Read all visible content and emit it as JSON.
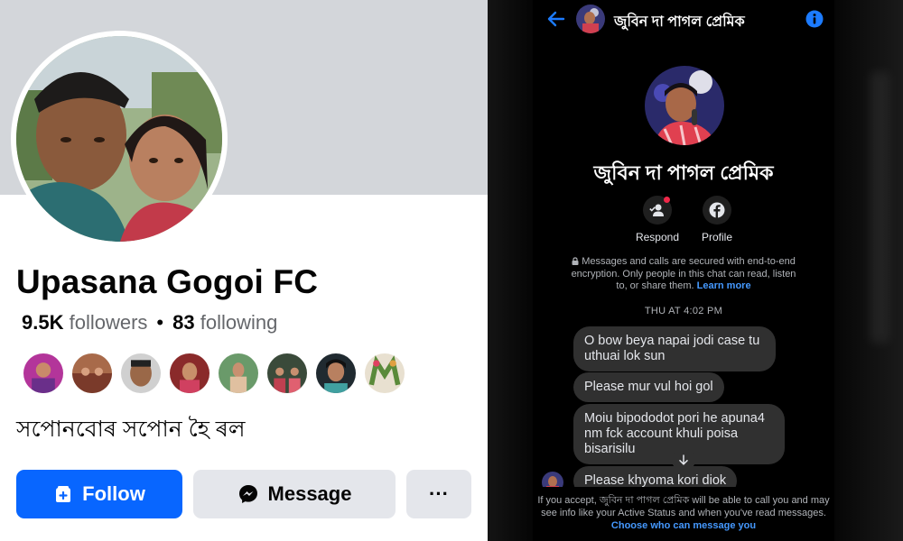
{
  "profile": {
    "name": "Upasana Gogoi FC",
    "followers_count": "9.5K",
    "followers_label": "followers",
    "separator": "•",
    "following_count": "83",
    "following_label": "following",
    "bio": "সপোনবোৰ সপোন হৈ ৰল",
    "follow_label": "Follow",
    "message_label": "Message",
    "more_label": "···"
  },
  "chat": {
    "title": "জুবিন দা পাগল প্রেমিক",
    "name": "জুবিন দা পাগল প্রেমিক",
    "respond_label": "Respond",
    "profile_label": "Profile",
    "secure_text": "Messages and calls are secured with end-to-end encryption. Only people in this chat can read, listen to, or share them.",
    "learn_more": "Learn more",
    "timestamp": "THU AT 4:02 PM",
    "messages": [
      "O bow beya napai jodi case tu uthuai lok sun",
      "Please mur  vul hoi gol",
      "Moiu bipododot pori he apuna4 nm fck account khuli poisa bisarisilu",
      "Please khyoma kori diok"
    ],
    "accept_text": "If you accept, জুবিন দা পাগল প্রেমিক will be able to call you and may see info like your Active Status and when you've read messages.",
    "choose_link": "Choose who can message you"
  },
  "colors": {
    "facebook_blue": "#0866ff",
    "messenger_link": "#4599ff",
    "bubble": "#303030",
    "notification_red": "#f02849"
  }
}
